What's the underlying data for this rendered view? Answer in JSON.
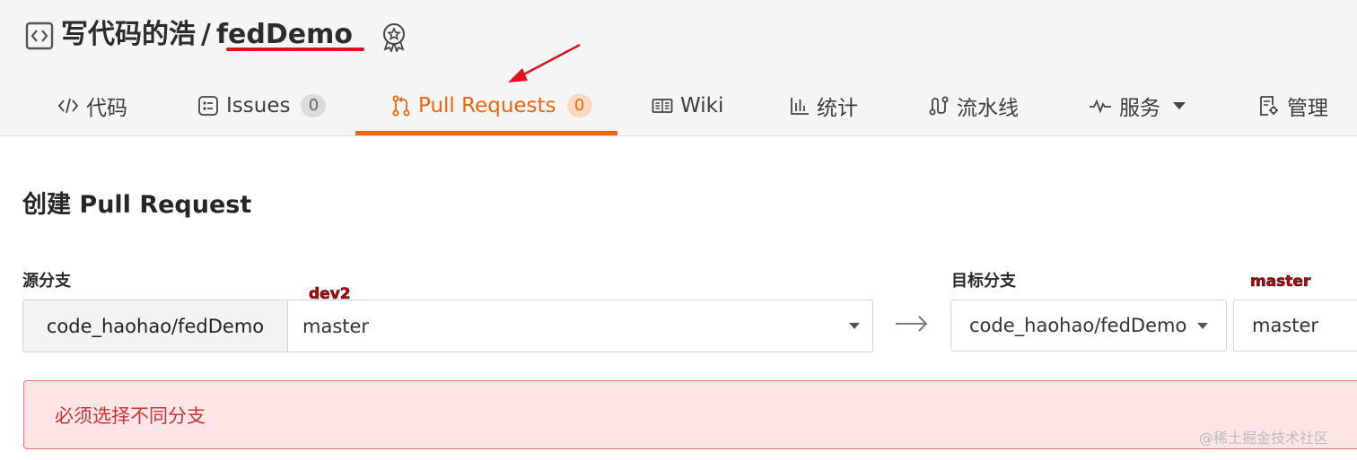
{
  "repo": {
    "owner": "写代码的浩",
    "separator": "/",
    "name": "fedDemo"
  },
  "nav": {
    "tabs": [
      {
        "label": "代码",
        "icon": "code-icon"
      },
      {
        "label": "Issues",
        "count": "0",
        "icon": "issues-icon"
      },
      {
        "label": "Pull Requests",
        "count": "0",
        "icon": "pull-request-icon",
        "active": true
      },
      {
        "label": "Wiki",
        "icon": "wiki-icon"
      },
      {
        "label": "统计",
        "icon": "chart-icon"
      },
      {
        "label": "流水线",
        "icon": "pipeline-icon"
      },
      {
        "label": "服务",
        "icon": "pulse-icon",
        "dropdown": true
      },
      {
        "label": "管理",
        "icon": "settings-doc-icon"
      }
    ]
  },
  "form": {
    "title": "创建 Pull Request",
    "source_label": "源分支",
    "source_repo": "code_haohao/fedDemo",
    "source_branch": "master",
    "target_label": "目标分支",
    "target_repo": "code_haohao/fedDemo",
    "target_branch": "master"
  },
  "annotations": {
    "source_note": "dev2",
    "target_note": "master"
  },
  "error": {
    "message": "必须选择不同分支"
  },
  "watermark": "@稀土掘金技术社区",
  "colors": {
    "accent": "#f0650b",
    "error_bg": "#fde5e5",
    "error_text": "#c9343a",
    "annotation_red": "#e0121c"
  }
}
